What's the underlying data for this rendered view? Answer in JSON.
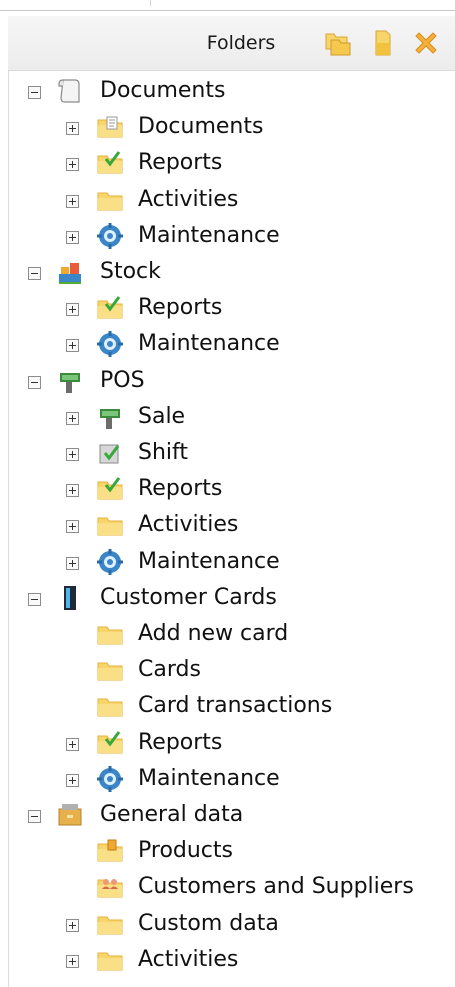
{
  "header": {
    "title": "Folders",
    "new_folder_icon": "new-folder-icon",
    "folder_icon": "folder-icon",
    "delete_icon": "delete-icon"
  },
  "colors": {
    "folder": "#f7d56a",
    "folder_shade": "#e4b23c",
    "check": "#38a83a",
    "gear": "#3a86c8",
    "delete": "#f0a830"
  },
  "tree": [
    {
      "label": "Documents",
      "icon": "document-scroll-icon",
      "expander": "minus"
    },
    {
      "label": "Documents",
      "icon": "document-folder-icon",
      "expander": "plus"
    },
    {
      "label": "Reports",
      "icon": "reports-folder-icon",
      "expander": "plus"
    },
    {
      "label": "Activities",
      "icon": "folder-icon",
      "expander": "plus"
    },
    {
      "label": "Maintenance",
      "icon": "maintenance-gear-icon",
      "expander": "plus"
    },
    {
      "label": "Stock",
      "icon": "stock-icon",
      "expander": "minus"
    },
    {
      "label": "Reports",
      "icon": "reports-folder-icon",
      "expander": "plus"
    },
    {
      "label": "Maintenance",
      "icon": "maintenance-gear-icon",
      "expander": "plus"
    },
    {
      "label": "POS",
      "icon": "pos-terminal-icon",
      "expander": "minus"
    },
    {
      "label": "Sale",
      "icon": "pos-terminal-icon",
      "expander": "plus"
    },
    {
      "label": "Shift",
      "icon": "shift-icon",
      "expander": "plus"
    },
    {
      "label": "Reports",
      "icon": "reports-folder-icon",
      "expander": "plus"
    },
    {
      "label": "Activities",
      "icon": "folder-icon",
      "expander": "plus"
    },
    {
      "label": "Maintenance",
      "icon": "maintenance-gear-icon",
      "expander": "plus"
    },
    {
      "label": "Customer Cards",
      "icon": "customer-card-icon",
      "expander": "minus"
    },
    {
      "label": "Add new card",
      "icon": "folder-icon",
      "expander": "none"
    },
    {
      "label": "Cards",
      "icon": "folder-icon",
      "expander": "none"
    },
    {
      "label": "Card transactions",
      "icon": "folder-icon",
      "expander": "none"
    },
    {
      "label": "Reports",
      "icon": "reports-folder-icon",
      "expander": "plus"
    },
    {
      "label": "Maintenance",
      "icon": "maintenance-gear-icon",
      "expander": "plus"
    },
    {
      "label": "General data",
      "icon": "general-data-icon",
      "expander": "minus"
    },
    {
      "label": "Products",
      "icon": "products-folder-icon",
      "expander": "none"
    },
    {
      "label": "Customers and Suppliers",
      "icon": "customers-folder-icon",
      "expander": "none"
    },
    {
      "label": "Custom data",
      "icon": "folder-icon",
      "expander": "plus"
    },
    {
      "label": "Activities",
      "icon": "folder-icon",
      "expander": "plus"
    }
  ]
}
